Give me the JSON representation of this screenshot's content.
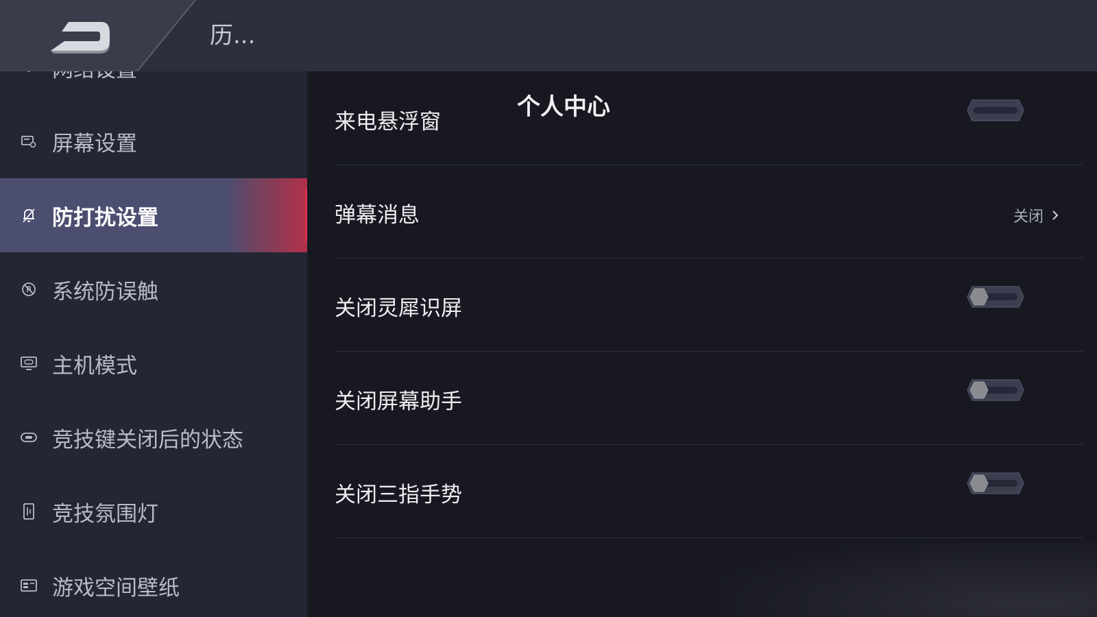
{
  "header": {
    "title_main": "个人中心",
    "title_sub": "历...",
    "back_icon": "back-arrow-icon"
  },
  "sidebar": {
    "items": [
      {
        "label": "网络设置",
        "icon": "wifi-icon",
        "active": false
      },
      {
        "label": "屏幕设置",
        "icon": "screen-settings-icon",
        "active": false
      },
      {
        "label": "防打扰设置",
        "icon": "bell-off-icon",
        "active": true
      },
      {
        "label": "系统防误触",
        "icon": "touch-block-icon",
        "active": false
      },
      {
        "label": "主机模式",
        "icon": "gamepad-monitor-icon",
        "active": false
      },
      {
        "label": "竞技键关闭后的状态",
        "icon": "switch-icon",
        "active": false
      },
      {
        "label": "竞技氛围灯",
        "icon": "light-bar-icon",
        "active": false
      },
      {
        "label": "游戏空间壁纸",
        "icon": "wallpaper-icon",
        "active": false
      }
    ]
  },
  "main": {
    "rows": [
      {
        "label": "来电悬浮窗",
        "control": "toggle",
        "state": "on"
      },
      {
        "label": "弹幕消息",
        "control": "link",
        "value": "关闭"
      },
      {
        "label": "关闭灵犀识屏",
        "control": "toggle",
        "state": "off"
      },
      {
        "label": "关闭屏幕助手",
        "control": "toggle",
        "state": "off"
      },
      {
        "label": "关闭三指手势",
        "control": "toggle",
        "state": "off"
      }
    ]
  },
  "colors": {
    "accent": "#e0344f",
    "active_bg": "#4c4e70",
    "sidebar_bg": "#242634",
    "main_bg": "#171820",
    "header_bg": "#2d2f3d"
  }
}
